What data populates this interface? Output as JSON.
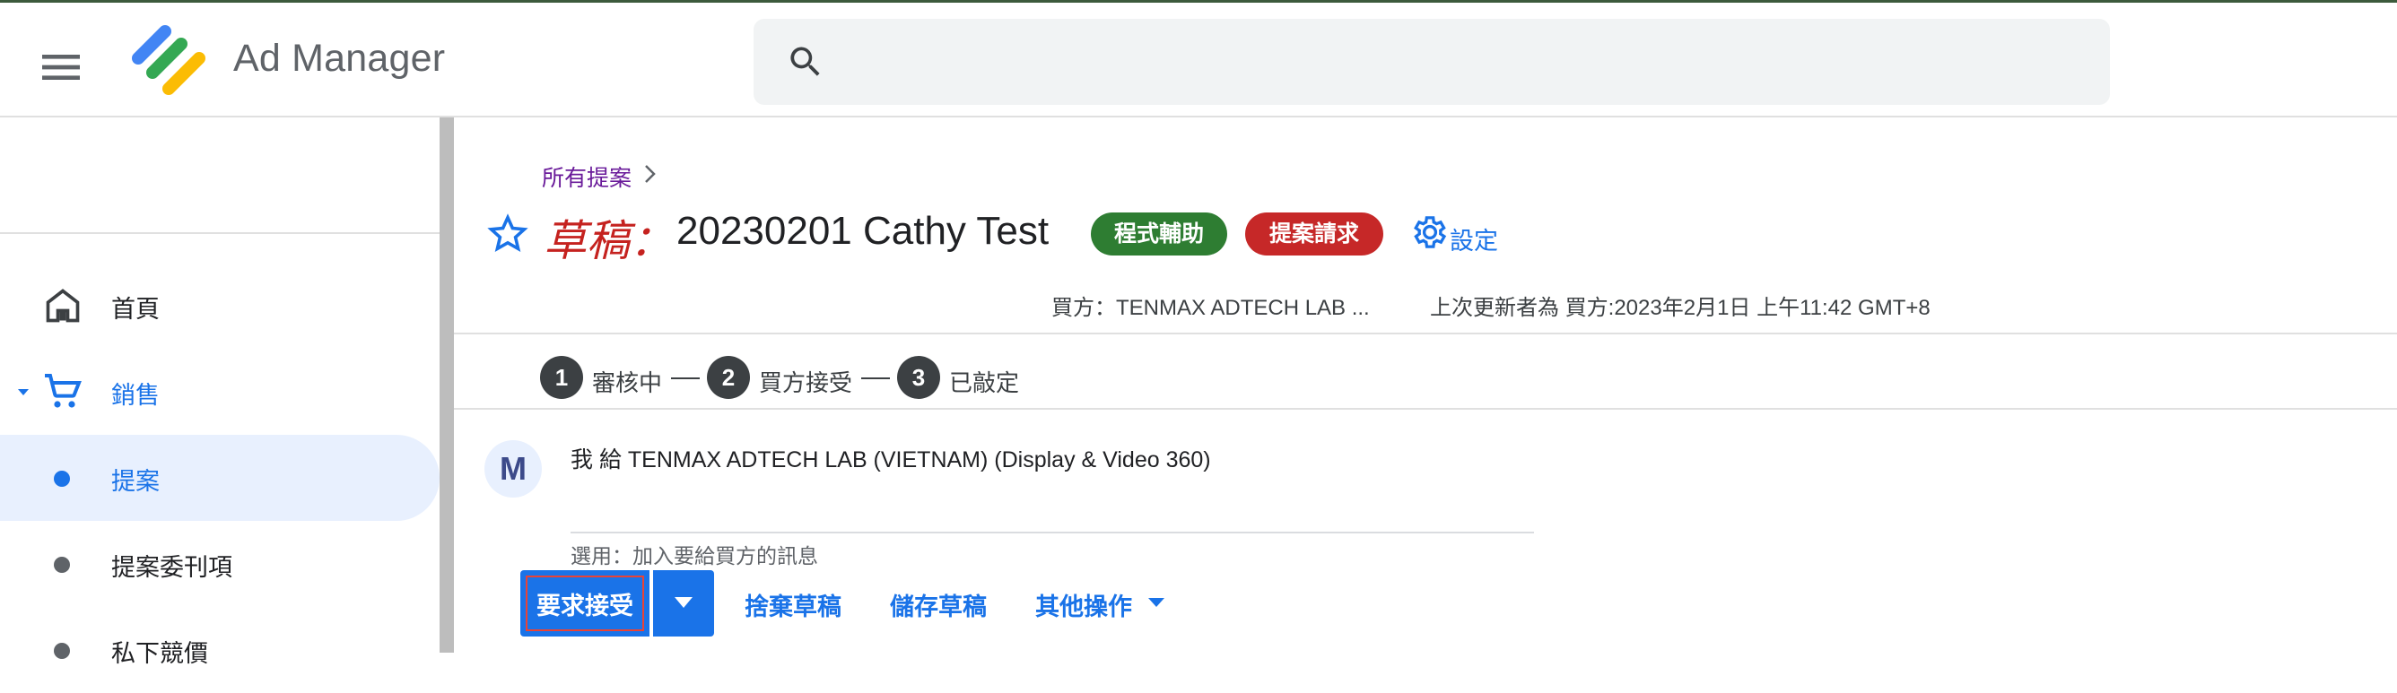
{
  "app": {
    "title": "Ad Manager"
  },
  "search": {
    "placeholder": ""
  },
  "sidebar": {
    "items": [
      {
        "label": "首頁",
        "icon": "home-icon"
      },
      {
        "label": "銷售",
        "icon": "cart-icon"
      },
      {
        "label": "提案",
        "active": true
      },
      {
        "label": "提案委刊項"
      },
      {
        "label": "私下競價"
      }
    ]
  },
  "proposal": {
    "breadcrumb": "所有提案",
    "draft_label": "草稿：",
    "name": "20230201 Cathy Test",
    "badges": [
      "程式輔助",
      "提案請求"
    ],
    "settings_label": "設定",
    "buyer": "買方：TENMAX ADTECH LAB ...",
    "last_updated": "上次更新者為 買方:2023年2月1日 上午11:42 GMT+8"
  },
  "steps": [
    {
      "num": "1",
      "label": "審核中"
    },
    {
      "num": "2",
      "label": "買方接受"
    },
    {
      "num": "3",
      "label": "已敲定"
    }
  ],
  "message": {
    "avatar_letter": "M",
    "to": "我 給 TENMAX ADTECH LAB (VIETNAM) (Display & Video 360)",
    "value": "",
    "hint": "選用：加入要給買方的訊息"
  },
  "actions": {
    "primary": "要求接受",
    "discard": "捨棄草稿",
    "save": "儲存草稿",
    "more": "其他操作"
  },
  "colors": {
    "accent": "#1a73e8",
    "draft": "#c5221f",
    "badge_programmatic": "#2e7d32",
    "badge_request": "#c62828"
  }
}
